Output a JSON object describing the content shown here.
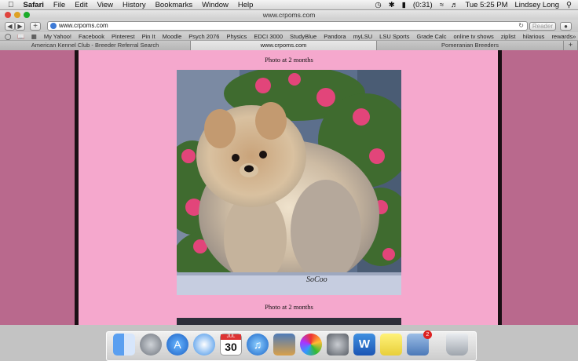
{
  "menubar": {
    "app": "Safari",
    "items": [
      "File",
      "Edit",
      "View",
      "History",
      "Bookmarks",
      "Window",
      "Help"
    ],
    "battery": "(0:31)",
    "clock": "Tue 5:25 PM",
    "user": "Lindsey Long"
  },
  "window": {
    "title": "www.crpoms.com"
  },
  "toolbar": {
    "url": "www.crpoms.com",
    "reader_label": "Reader"
  },
  "bookmarks": [
    "My Yahoo!",
    "Facebook",
    "Pinterest",
    "Pin It",
    "Moodle",
    "Psych 2076",
    "Physics",
    "EDCI 3000",
    "StudyBlue",
    "Pandora",
    "myLSU",
    "LSU Sports",
    "Grade Calc",
    "online tv shows",
    "ziplist",
    "hilarious",
    "rewards"
  ],
  "tabs": [
    {
      "label": "American Kennel Club - Breeder Referral Search"
    },
    {
      "label": "www.crpoms.com",
      "active": true
    },
    {
      "label": "Pomeranian Breeders"
    }
  ],
  "page": {
    "caption_top": "Photo at 2 months",
    "caption_bottom": "Photo at 2 months",
    "watermark": "SoCoo"
  },
  "dock": {
    "icons": [
      "finder-icon",
      "launchpad-icon",
      "app-store-icon",
      "safari-icon",
      "calendar-icon",
      "itunes-icon",
      "iphoto-icon",
      "picasa-icon",
      "system-preferences-icon",
      "word-icon",
      "stickies-icon",
      "preview-icon",
      "trash-icon"
    ],
    "calendar_day": "30",
    "calendar_month": "JUL",
    "badge": "2"
  },
  "colors": {
    "page_bg": "#f5a8cd",
    "side_bg": "#b9698d"
  }
}
